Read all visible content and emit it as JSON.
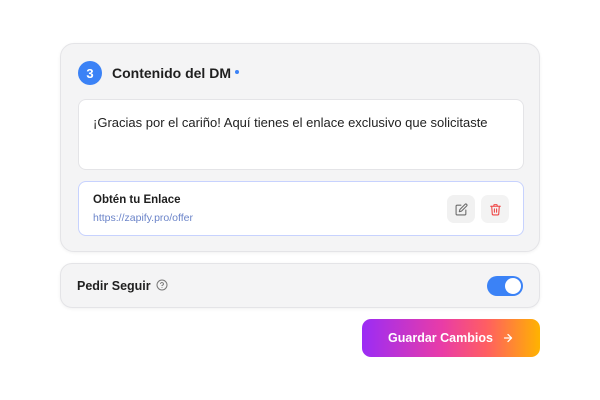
{
  "dm_card": {
    "step_number": "3",
    "title": "Contenido del DM",
    "message": "¡Gracias por el cariño! Aquí tienes el enlace exclusivo que solicitaste",
    "link": {
      "title": "Obtén tu Enlace",
      "url": "https://zapify.pro/offer",
      "edit_icon": "pencil-square-icon",
      "delete_icon": "trash-icon"
    }
  },
  "follow_card": {
    "label": "Pedir Seguir",
    "help_icon": "question-circle-icon",
    "toggle_on": true
  },
  "save_button": {
    "label": "Guardar Cambios",
    "icon": "arrow-right-icon"
  },
  "colors": {
    "accent": "#3b82f6",
    "delete": "#ef4444",
    "gradient": [
      "#9b2cf5",
      "#e93ca7",
      "#ff5e62",
      "#ffb300"
    ]
  }
}
